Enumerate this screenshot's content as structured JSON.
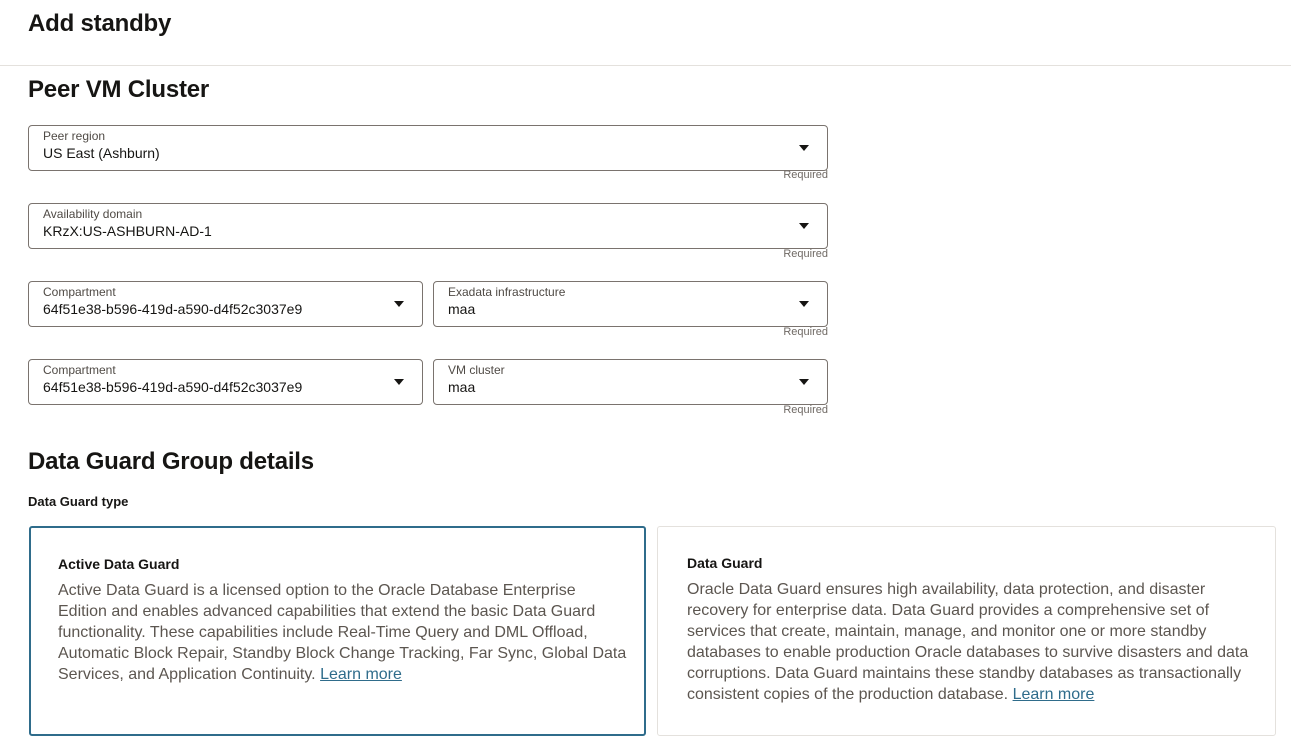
{
  "header": {
    "title": "Add standby"
  },
  "peer_vm_cluster": {
    "title": "Peer VM Cluster",
    "peer_region": {
      "label": "Peer region",
      "value": "US East (Ashburn)",
      "required": "Required"
    },
    "availability_domain": {
      "label": "Availability domain",
      "value": "KRzX:US-ASHBURN-AD-1",
      "required": "Required"
    },
    "infra_compartment": {
      "label": "Compartment",
      "value": "64f51e38-b596-419d-a590-d4f52c3037e9"
    },
    "exadata_infrastructure": {
      "label": "Exadata infrastructure",
      "value": "maa",
      "required": "Required"
    },
    "cluster_compartment": {
      "label": "Compartment",
      "value": "64f51e38-b596-419d-a590-d4f52c3037e9"
    },
    "vm_cluster": {
      "label": "VM cluster",
      "value": "maa",
      "required": "Required"
    }
  },
  "data_guard_group": {
    "title": "Data Guard Group details",
    "type_label": "Data Guard type",
    "options": [
      {
        "title": "Active Data Guard",
        "description": "Active Data Guard is a licensed option to the Oracle Database Enterprise Edition and enables advanced capabilities that extend the basic Data Guard functionality. These capabilities include Real-Time Query and DML Offload, Automatic Block Repair, Standby Block Change Tracking, Far Sync, Global Data Services, and Application Continuity.",
        "link": "Learn more",
        "selected": true
      },
      {
        "title": "Data Guard",
        "description": "Oracle Data Guard ensures high availability, data protection, and disaster recovery for enterprise data. Data Guard provides a comprehensive set of services that create, maintain, manage, and monitor one or more standby databases to enable production Oracle databases to survive disasters and data corruptions. Data Guard maintains these standby databases as transactionally consistent copies of the production database.",
        "link": "Learn more",
        "selected": false
      }
    ]
  },
  "colors": {
    "accent": "#2f6c8b",
    "border": "#7a736e",
    "text": "#161513",
    "muted_text": "#5c5650"
  },
  "icons": {
    "dropdown": "chevron-down-icon"
  }
}
